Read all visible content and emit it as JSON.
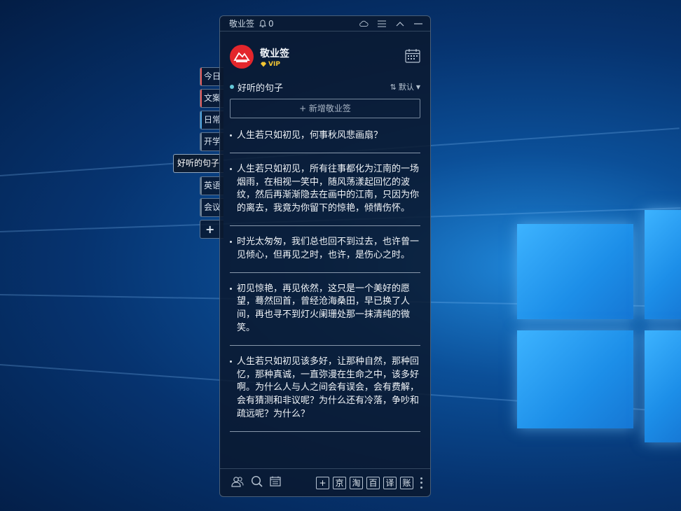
{
  "titlebar": {
    "app_name": "敬业签",
    "notification_count": "0",
    "icons": [
      "cloud-icon",
      "menu-icon",
      "collapse-icon",
      "minimize-icon"
    ]
  },
  "profile": {
    "name": "敬业签",
    "badge": "VIP",
    "brand_color": "#e3262c",
    "vip_color": "#f3c633"
  },
  "categories": [
    {
      "label": "今日",
      "accent": "#e35a5a"
    },
    {
      "label": "文案",
      "accent": "#e35a5a"
    },
    {
      "label": "日常",
      "accent": "#4aa3df"
    },
    {
      "label": "开学",
      "accent": "#6a7f96"
    },
    {
      "label": "好听的句子",
      "accent": "#6a7f96"
    },
    {
      "label": "英语",
      "accent": "#6a7f96"
    },
    {
      "label": "会议",
      "accent": "#6a7f96"
    },
    {
      "label": "+",
      "accent": "#6a7f96"
    }
  ],
  "list": {
    "title": "好听的句子",
    "sort_label": "默认",
    "add_button": "+ 新增敬业签"
  },
  "notes": [
    "人生若只如初见，何事秋风悲画扇？",
    "人生若只如初见，所有往事都化为江南的一场烟雨，在相视一笑中，随风荡漾起回忆的波纹，然后再渐渐隐去在画中的江南，只因为你的离去，我竟为你留下的惊艳，倾情伤怀。",
    "时光太匆匆，我们总也回不到过去，也许曾一见倾心，但再见之时，也许，是伤心之时。",
    "初见惊艳，再见依然，这只是一个美好的愿望，蓦然回首，曾经沧海桑田，早已换了人间，再也寻不到灯火阑珊处那一抹清纯的微笑。",
    "人生若只如初见该多好，让那种自然，那种回忆，那种真诚，一直弥漫在生命之中，该多好啊。为什么人与人之间会有误会，会有费解，会有猜测和非议呢？为什么还有冷落，争吵和疏远呢？为什么？"
  ],
  "bottom_bar": {
    "left_icons": [
      "contacts-icon",
      "search-icon",
      "calendar-list-icon"
    ],
    "quick_buttons": [
      "+",
      "京",
      "淘",
      "百",
      "译",
      "账"
    ]
  }
}
